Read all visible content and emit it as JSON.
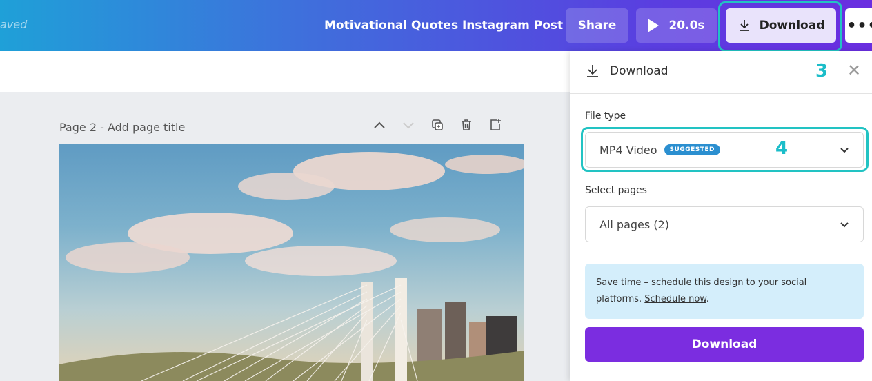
{
  "header": {
    "saved_text": "aved",
    "document_title": "Motivational Quotes Instagram Post",
    "share_label": "Share",
    "duration_label": "20.0s",
    "download_label": "Download",
    "more_label": "•••"
  },
  "page": {
    "title": "Page 2 - Add page title"
  },
  "download_panel": {
    "title": "Download",
    "step_marker_close": "3",
    "close_symbol": "✕",
    "file_type_label": "File type",
    "file_type_value": "MP4 Video",
    "suggested_badge": "SUGGESTED",
    "step_marker_file_type": "4",
    "select_pages_label": "Select pages",
    "select_pages_value": "All pages (2)",
    "info_text": "Save time – schedule this design to your social platforms. ",
    "info_link": "Schedule now",
    "info_suffix": ".",
    "download_button": "Download"
  },
  "colors": {
    "accent_teal": "#22c3c3",
    "primary_purple": "#7b2de0",
    "info_bg": "#d4eefb",
    "badge_blue": "#2b8fd0"
  },
  "icons": [
    "download-icon",
    "play-icon",
    "more-icon",
    "close-icon",
    "chevron-up-icon",
    "chevron-down-icon",
    "duplicate-icon",
    "trash-icon",
    "add-page-icon"
  ]
}
